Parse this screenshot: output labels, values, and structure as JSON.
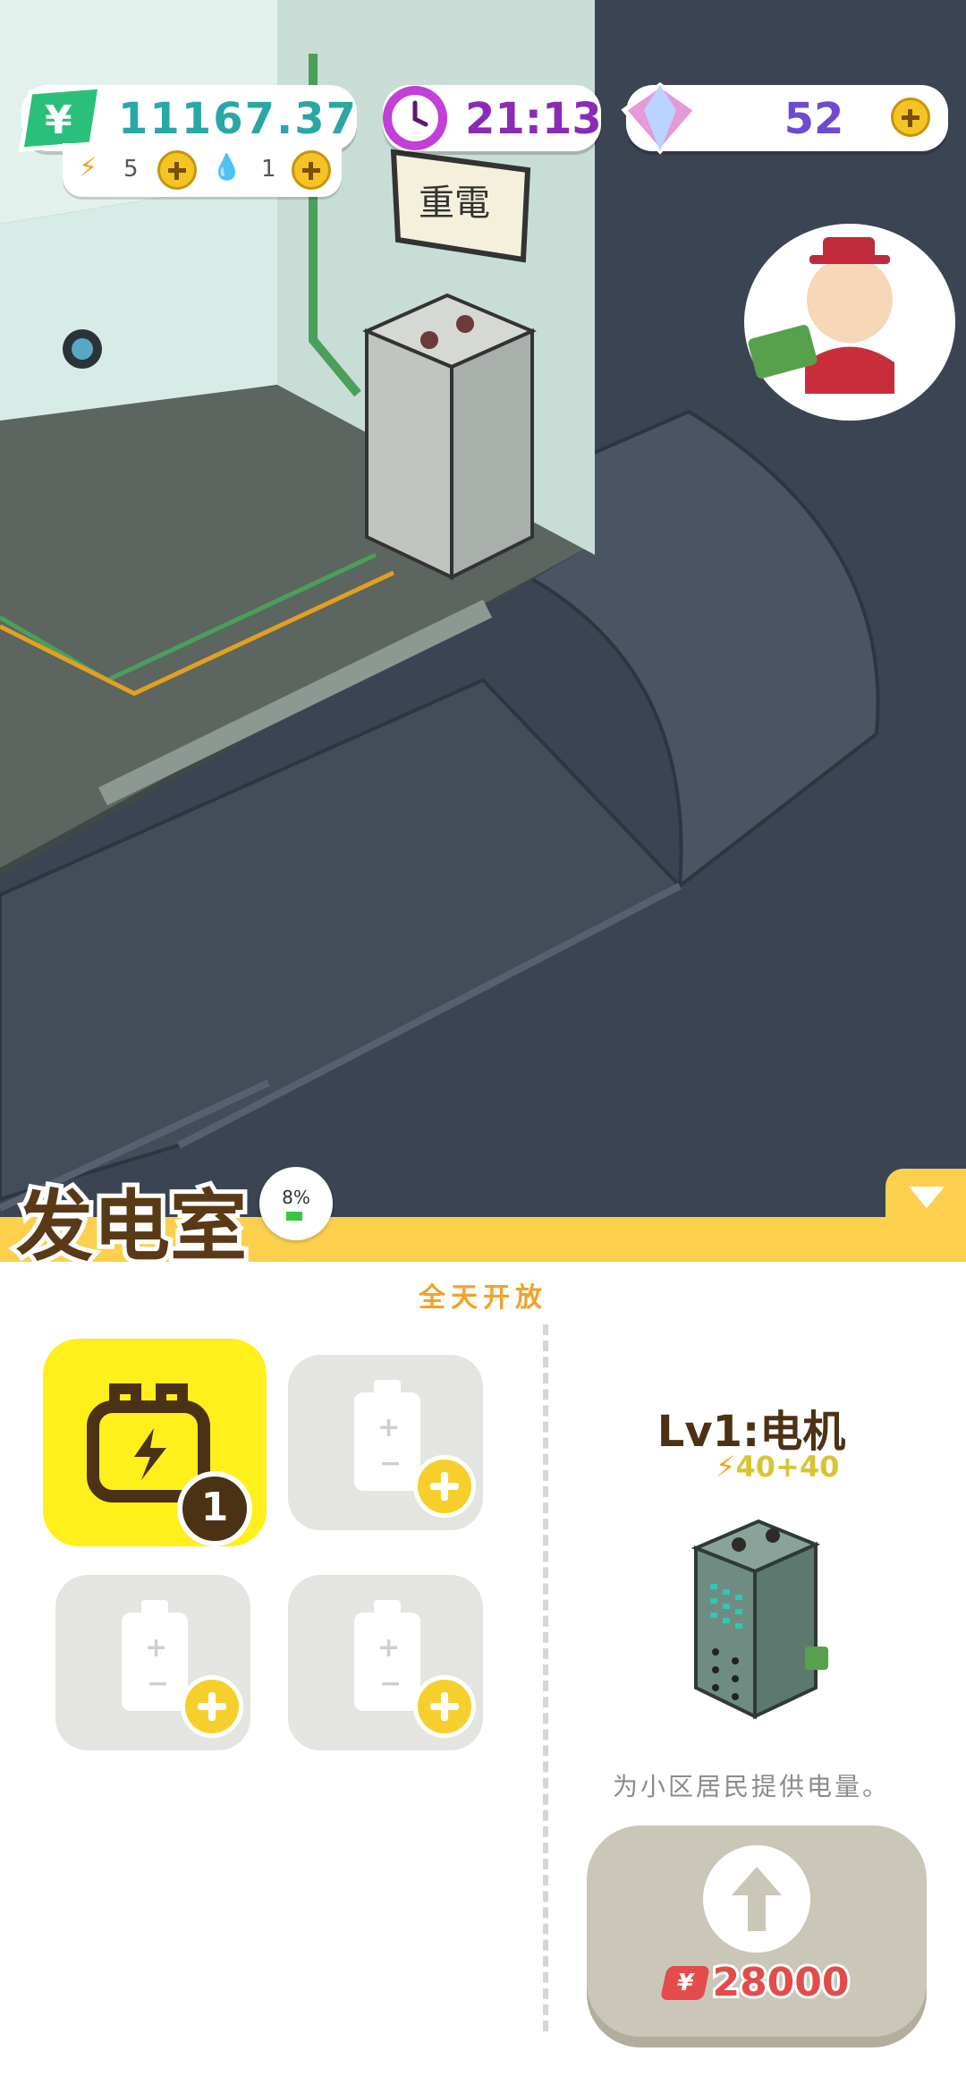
{
  "hud": {
    "money": "11167.37",
    "energy": "5",
    "water": "1",
    "time": "21:13",
    "gems": "52"
  },
  "scene": {
    "wall_sign": "重電"
  },
  "room": {
    "title": "发电室",
    "progress": "8%",
    "progress_value": 0.08,
    "open_hours": "全天开放",
    "active_slot_count": "1"
  },
  "generator": {
    "level_title": "Lv1:电机",
    "stat": "40+40",
    "description": "为小区居民提供电量。",
    "upgrade_price": "28000",
    "currency_symbol": "¥"
  },
  "colors": {
    "accent_yellow": "#fcd04d",
    "active_slot": "#ffef1a",
    "price_red": "#e44b4b",
    "money_teal": "#2aa7a5"
  }
}
